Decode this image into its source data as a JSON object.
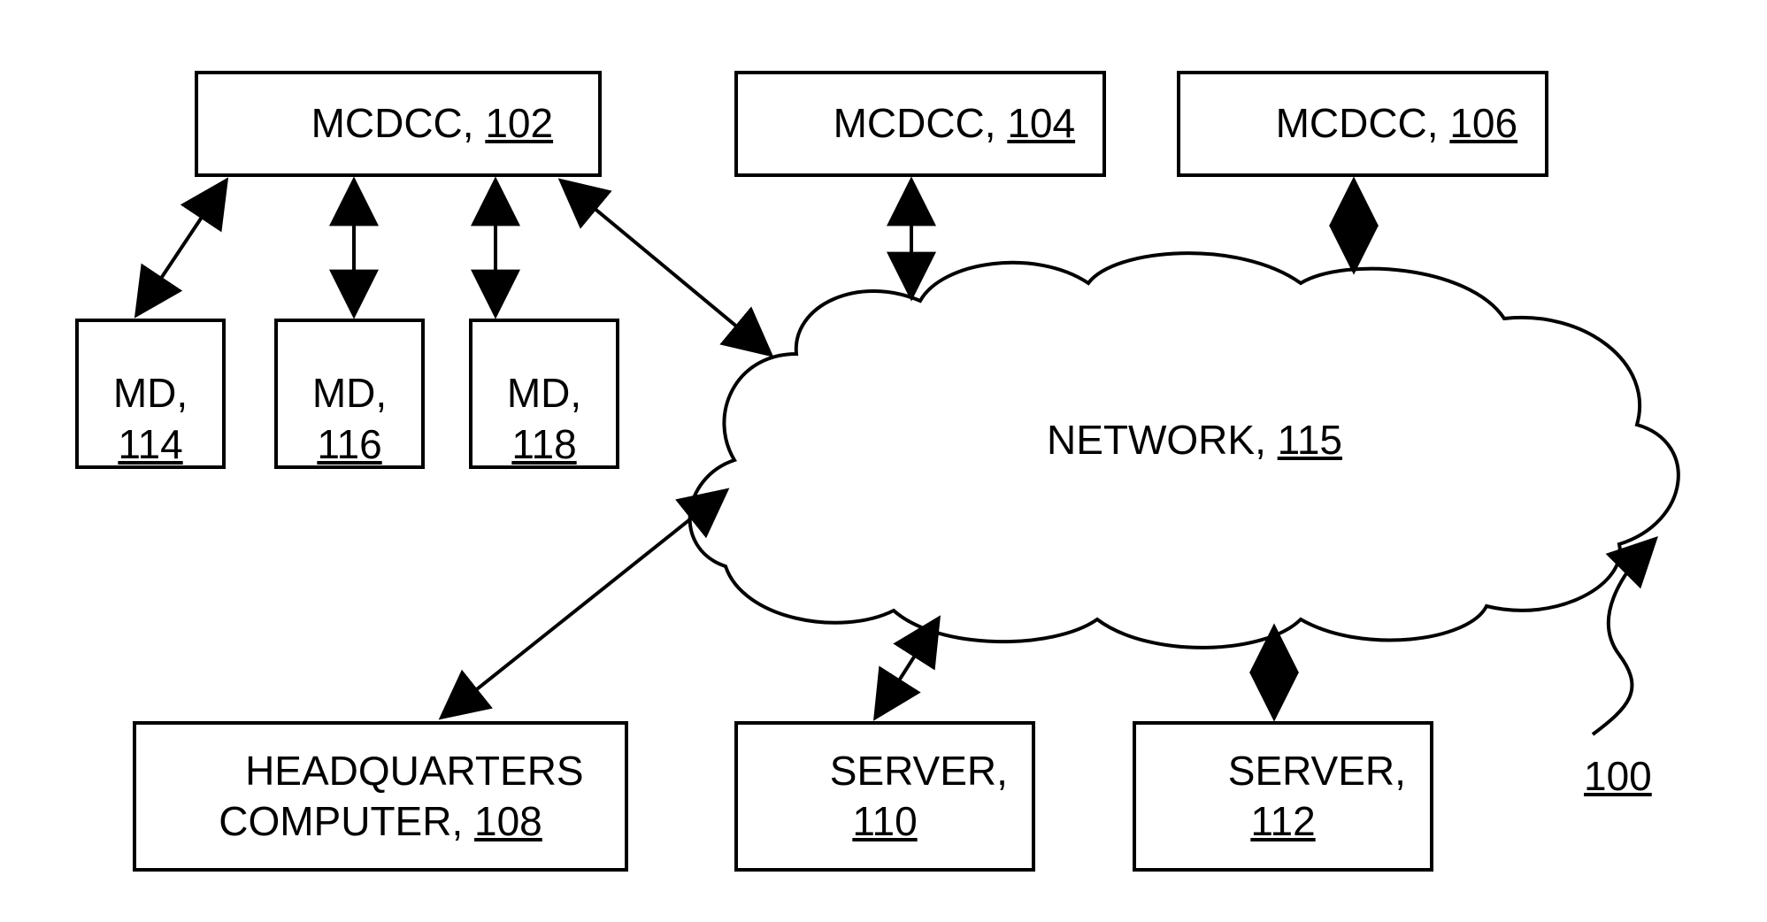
{
  "diagram": {
    "type": "network-block-diagram",
    "figure_ref": "100",
    "nodes": {
      "mcdcc_102": {
        "name": "MCDCC",
        "ref": "102"
      },
      "mcdcc_104": {
        "name": "MCDCC",
        "ref": "104"
      },
      "mcdcc_106": {
        "name": "MCDCC",
        "ref": "106"
      },
      "md_114": {
        "name": "MD",
        "ref": "114"
      },
      "md_116": {
        "name": "MD",
        "ref": "116"
      },
      "md_118": {
        "name": "MD",
        "ref": "118"
      },
      "network": {
        "name": "NETWORK",
        "ref": "115"
      },
      "hq": {
        "line1": "HEADQUARTERS",
        "line2": "COMPUTER",
        "ref": "108"
      },
      "server_110": {
        "name": "SERVER",
        "ref": "110"
      },
      "server_112": {
        "name": "SERVER",
        "ref": "112"
      }
    },
    "edges": [
      {
        "from": "mcdcc_102",
        "to": "md_114",
        "bidirectional": true
      },
      {
        "from": "mcdcc_102",
        "to": "md_116",
        "bidirectional": true
      },
      {
        "from": "mcdcc_102",
        "to": "md_118",
        "bidirectional": true
      },
      {
        "from": "mcdcc_102",
        "to": "network",
        "bidirectional": true
      },
      {
        "from": "mcdcc_104",
        "to": "network",
        "bidirectional": true
      },
      {
        "from": "mcdcc_106",
        "to": "network",
        "bidirectional": true
      },
      {
        "from": "hq",
        "to": "network",
        "bidirectional": true
      },
      {
        "from": "server_110",
        "to": "network",
        "bidirectional": true
      },
      {
        "from": "server_112",
        "to": "network",
        "bidirectional": true
      }
    ]
  }
}
